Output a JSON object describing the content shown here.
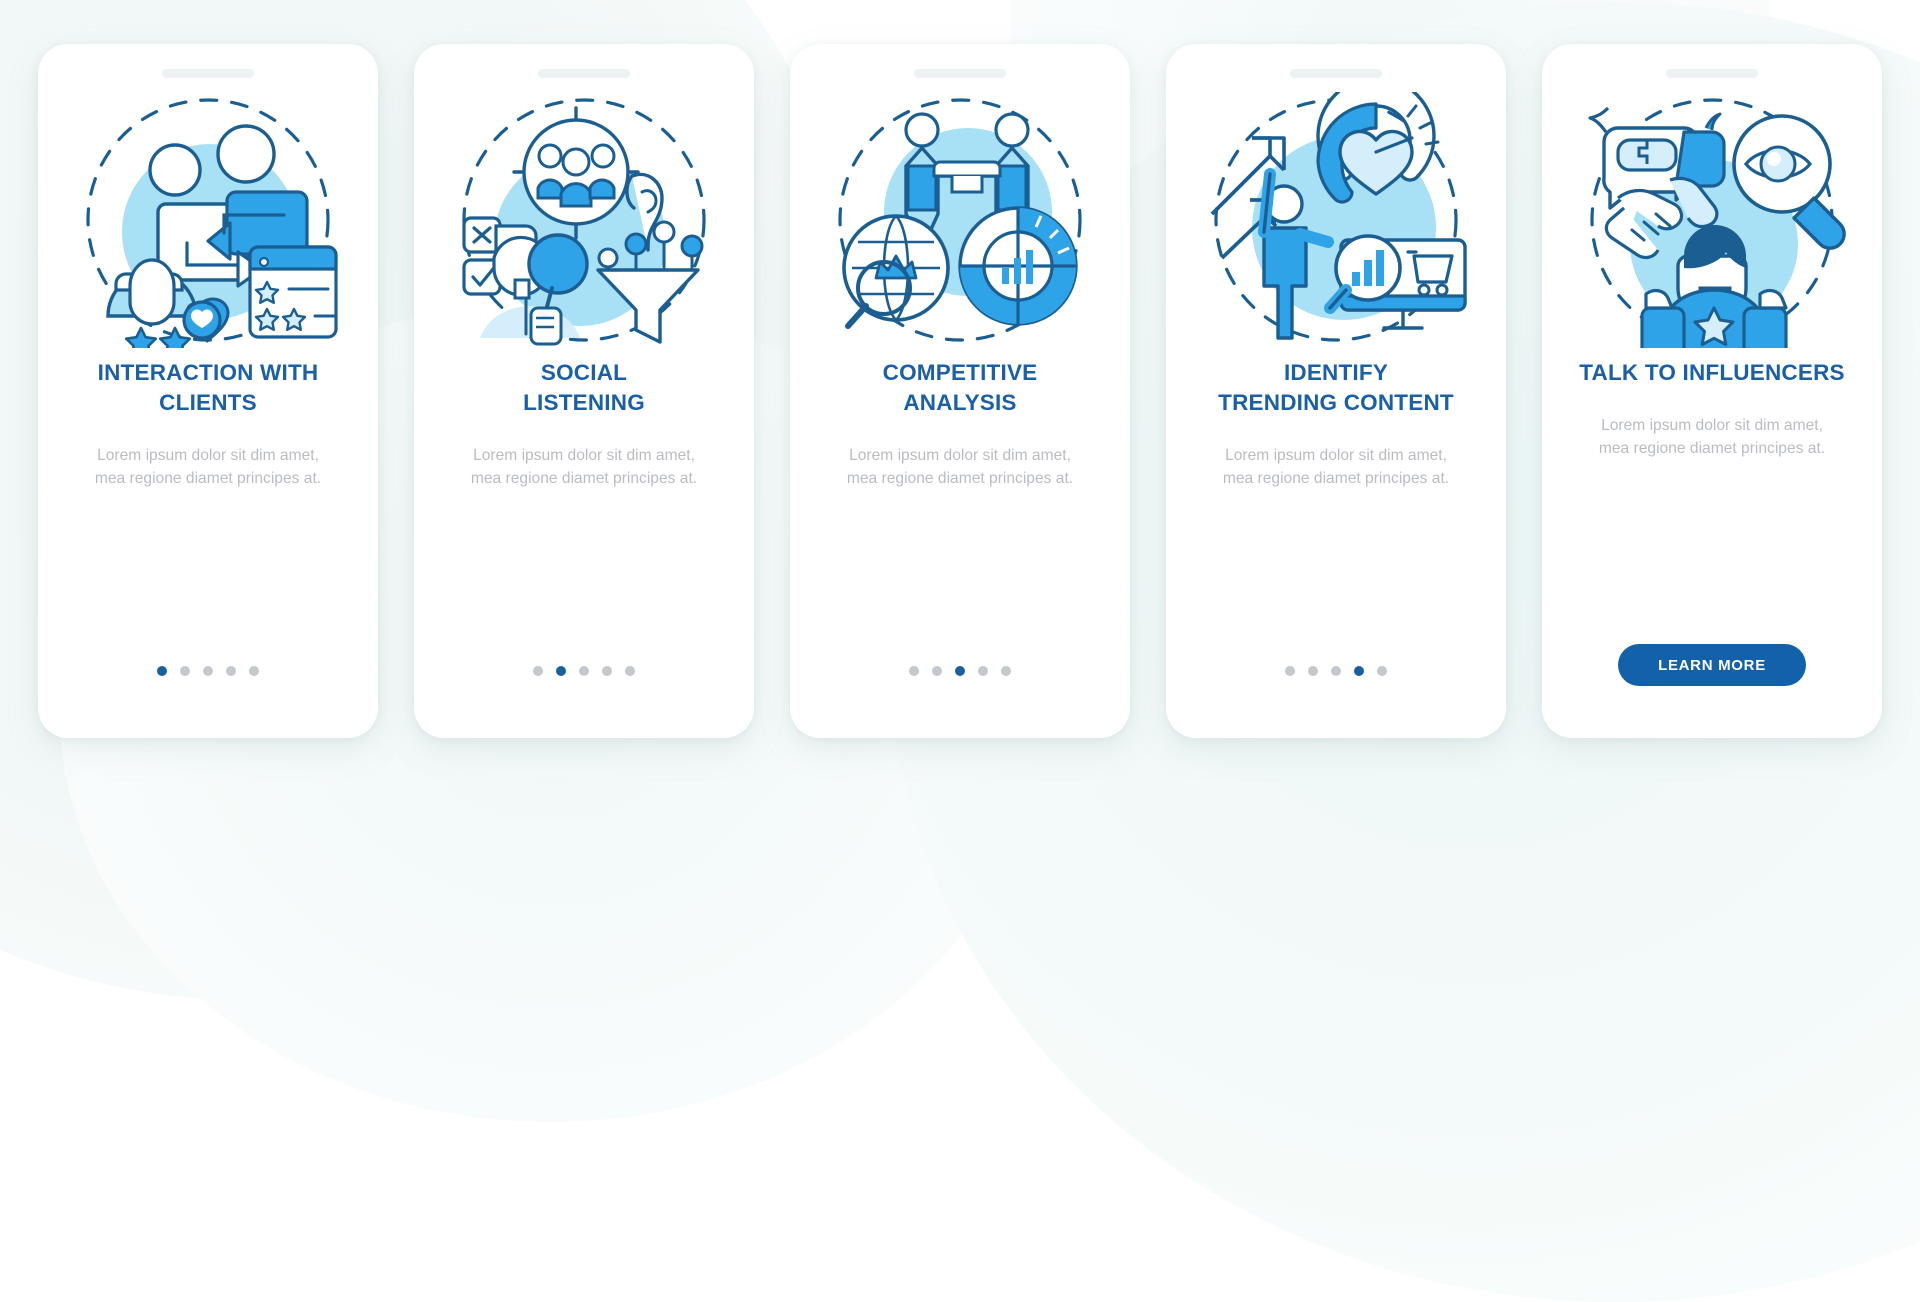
{
  "colors": {
    "title_blue": "#1a5fa8",
    "body_gray": "#b9bcc0",
    "dot_active": "#18619e",
    "dot_inactive": "#c5c8cc",
    "cta_bg": "#1360ab",
    "cta_text": "#ffffff",
    "art_stroke_dark": "#1b5e92",
    "art_fill_mid": "#2ea3e8",
    "art_fill_light": "#a8e0f5",
    "art_fill_pale": "#d4eefb",
    "page_bg": "#ffffff",
    "card_bg": "#ffffff",
    "notch": "#eef1f1"
  },
  "body_text": "Lorem ipsum dolor sit dim amet, mea regione diamet principes at.",
  "dots_total": 5,
  "screens": [
    {
      "title": "INTERACTION WITH CLIENTS",
      "title_lines": [
        "INTERACTION WITH",
        "CLIENTS"
      ],
      "body": "Lorem ipsum dolor sit dim amet, mea regione diamet principes at.",
      "active_dot": 1,
      "has_cta": false,
      "cta_label": "",
      "illustration": "interaction-with-clients-illustration"
    },
    {
      "title": "SOCIAL LISTENING",
      "title_lines": [
        "SOCIAL",
        "LISTENING"
      ],
      "body": "Lorem ipsum dolor sit dim amet, mea regione diamet principes at.",
      "active_dot": 2,
      "has_cta": false,
      "cta_label": "",
      "illustration": "social-listening-illustration"
    },
    {
      "title": "COMPETITIVE ANALYSIS",
      "title_lines": [
        "COMPETITIVE",
        "ANALYSIS"
      ],
      "body": "Lorem ipsum dolor sit dim amet, mea regione diamet principes at.",
      "active_dot": 3,
      "has_cta": false,
      "cta_label": "",
      "illustration": "competitive-analysis-illustration"
    },
    {
      "title": "IDENTIFY TRENDING CONTENT",
      "title_lines": [
        "IDENTIFY",
        "TRENDING CONTENT"
      ],
      "body": "Lorem ipsum dolor sit dim amet, mea regione diamet principes at.",
      "active_dot": 4,
      "has_cta": false,
      "cta_label": "",
      "illustration": "identify-trending-content-illustration"
    },
    {
      "title": "TALK TO INFLUENCERS",
      "title_lines": [
        "TALK TO INFLUENCERS"
      ],
      "body": "Lorem ipsum dolor sit dim amet, mea regione diamet principes at.",
      "active_dot": 0,
      "has_cta": true,
      "cta_label": "LEARN MORE",
      "illustration": "talk-to-influencers-illustration"
    }
  ]
}
